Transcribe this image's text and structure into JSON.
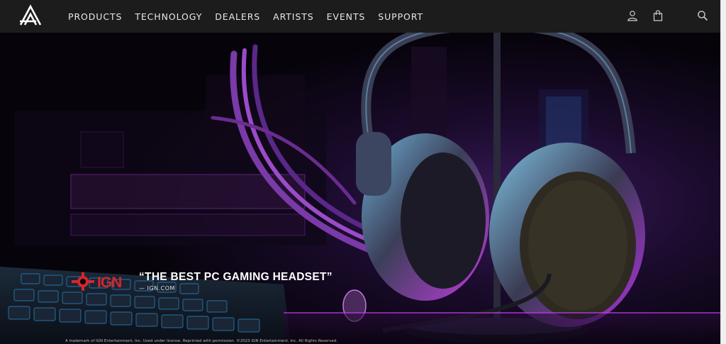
{
  "header": {
    "logo_icon": "audeze-a-logo-icon",
    "nav": [
      {
        "label": "PRODUCTS"
      },
      {
        "label": "TECHNOLOGY"
      },
      {
        "label": "DEALERS"
      },
      {
        "label": "ARTISTS"
      },
      {
        "label": "EVENTS"
      },
      {
        "label": "SUPPORT"
      }
    ],
    "icons": [
      "account-icon",
      "cart-icon",
      "search-icon"
    ]
  },
  "hero": {
    "badge_icon": "ign-logo-icon",
    "quote": "“THE BEST PC GAMING HEADSET”",
    "source": "— IGN.COM",
    "disclaimer": "A trademark of IGN Entertainment, Inc. Used under license. Reprinted with permission. ©2023 IGN Entertainment, Inc. All Rights Reserved."
  },
  "colors": {
    "header_bg": "#1c1c1c",
    "accent_magenta": "#c43cff",
    "accent_blue": "#2aa7ff",
    "ign_red": "#d6262a"
  }
}
